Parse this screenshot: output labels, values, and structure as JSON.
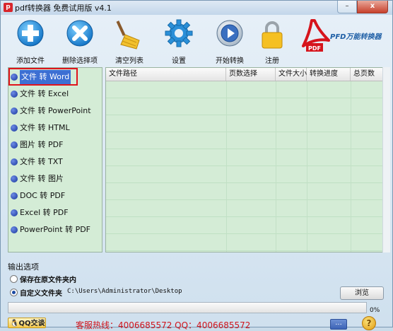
{
  "window": {
    "title": "pdf转换器 免费试用版 v4.1",
    "minimize_label": "–",
    "close_label": "x"
  },
  "toolbar": {
    "items": [
      {
        "label": "添加文件",
        "icon": "plus-icon"
      },
      {
        "label": "删除选择项",
        "icon": "delete-icon"
      },
      {
        "label": "清空列表",
        "icon": "broom-icon"
      },
      {
        "label": "设置",
        "icon": "gear-icon"
      },
      {
        "label": "开始转换",
        "icon": "play-icon"
      },
      {
        "label": "注册",
        "icon": "lock-icon"
      }
    ],
    "logo": {
      "text": "PFD万能转换器",
      "badge": "PDF",
      "icon": "pdf-logo-icon"
    }
  },
  "conversions": {
    "selected_index": 0,
    "items": [
      "文件 转 Word",
      "文件 转 Excel",
      "文件 转 PowerPoint",
      "文件 转 HTML",
      "图片 转 PDF",
      "文件 转 TXT",
      "文件 转 图片",
      "DOC 转 PDF",
      "Excel 转 PDF",
      "PowerPoint 转 PDF"
    ]
  },
  "file_table": {
    "columns": [
      "文件路径",
      "页数选择",
      "文件大小",
      "转换进度",
      "总页数"
    ],
    "rows": []
  },
  "output": {
    "section_title": "输出选项",
    "option_original": "保存在原文件夹内",
    "option_custom": "自定义文件夹",
    "selected": "custom",
    "path": "C:\\Users\\Administrator\\Desktop",
    "browse_label": "浏览"
  },
  "progress": {
    "value": 0,
    "label": "0%"
  },
  "footer": {
    "qq_label": "QQ交谈",
    "hotline": "客服热线：4006685572 QQ：4006685572",
    "more_label": "...",
    "help_label": "?"
  },
  "colors": {
    "panel_green": "#d4ecd6",
    "accent_blue": "#3c6fd3",
    "highlight_red": "#e0141c"
  }
}
